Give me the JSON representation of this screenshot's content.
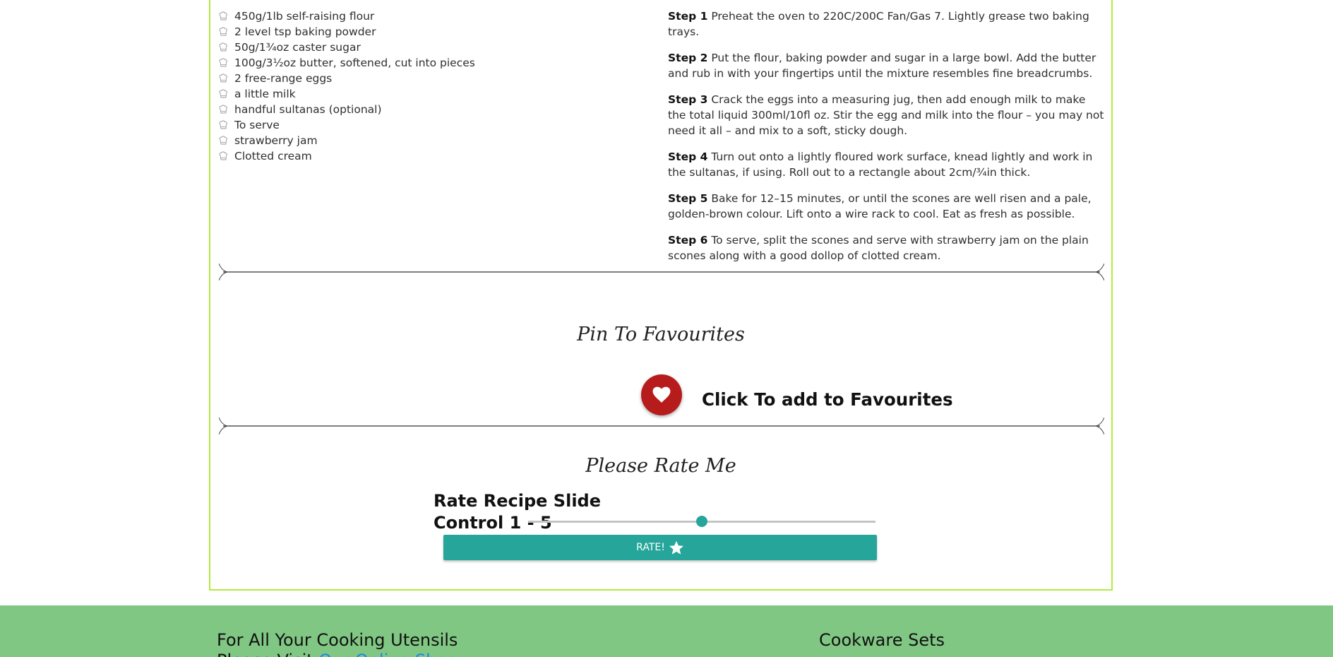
{
  "ingredients": [
    "450g/1lb self-raising flour",
    "2 level tsp baking powder",
    "50g/1¾oz caster sugar",
    "100g/3½oz butter, softened, cut into pieces",
    "2 free-range eggs",
    "a little milk",
    "handful sultanas (optional)",
    "To serve",
    "strawberry jam",
    "Clotted cream"
  ],
  "method": [
    {
      "label": "Step 1",
      "text": "Preheat the oven to 220C/200C Fan/Gas 7. Lightly grease two baking trays."
    },
    {
      "label": "Step 2",
      "text": "Put the flour, baking powder and sugar in a large bowl. Add the butter and rub in with your fingertips until the mixture resembles fine breadcrumbs."
    },
    {
      "label": "Step 3",
      "text": "Crack the eggs into a measuring jug, then add enough milk to make the total liquid 300ml/10fl oz. Stir the egg and milk into the flour – you may not need it all – and mix to a soft, sticky dough."
    },
    {
      "label": "Step 4",
      "text": "Turn out onto a lightly floured work surface, knead lightly and work in the sultanas, if using. Roll out to a rectangle about 2cm/¾in thick."
    },
    {
      "label": "Step 5",
      "text": "Bake for 12–15 minutes, or until the scones are well risen and a pale, golden-brown colour. Lift onto a wire rack to cool. Eat as fresh as possible."
    },
    {
      "label": "Step 6",
      "text": "To serve, split the scones and serve with strawberry jam on the plain scones along with a good dollop of clotted cream."
    }
  ],
  "favourites": {
    "title": "Pin To Favourites",
    "button_icon": "heart-icon",
    "label": "Click To add to Favourites"
  },
  "rating": {
    "title": "Please Rate Me",
    "slider_label": "Rate Recipe Slide Control 1 - 5",
    "min": 1,
    "max": 5,
    "value": 3,
    "button_label": "RATE!",
    "button_icon": "star-icon"
  },
  "footer": {
    "left_heading": "For All Your Cooking Utensils",
    "left_line2_prefix": "Please Visit ",
    "left_link": "Our Online Shop",
    "right_heading": "Cookware Sets"
  },
  "colors": {
    "card_border": "#b2eb3f",
    "heart_button": "#b71c1c",
    "accent": "#26a69a",
    "footer_bg": "#81c784",
    "link": "#1e88e5"
  }
}
